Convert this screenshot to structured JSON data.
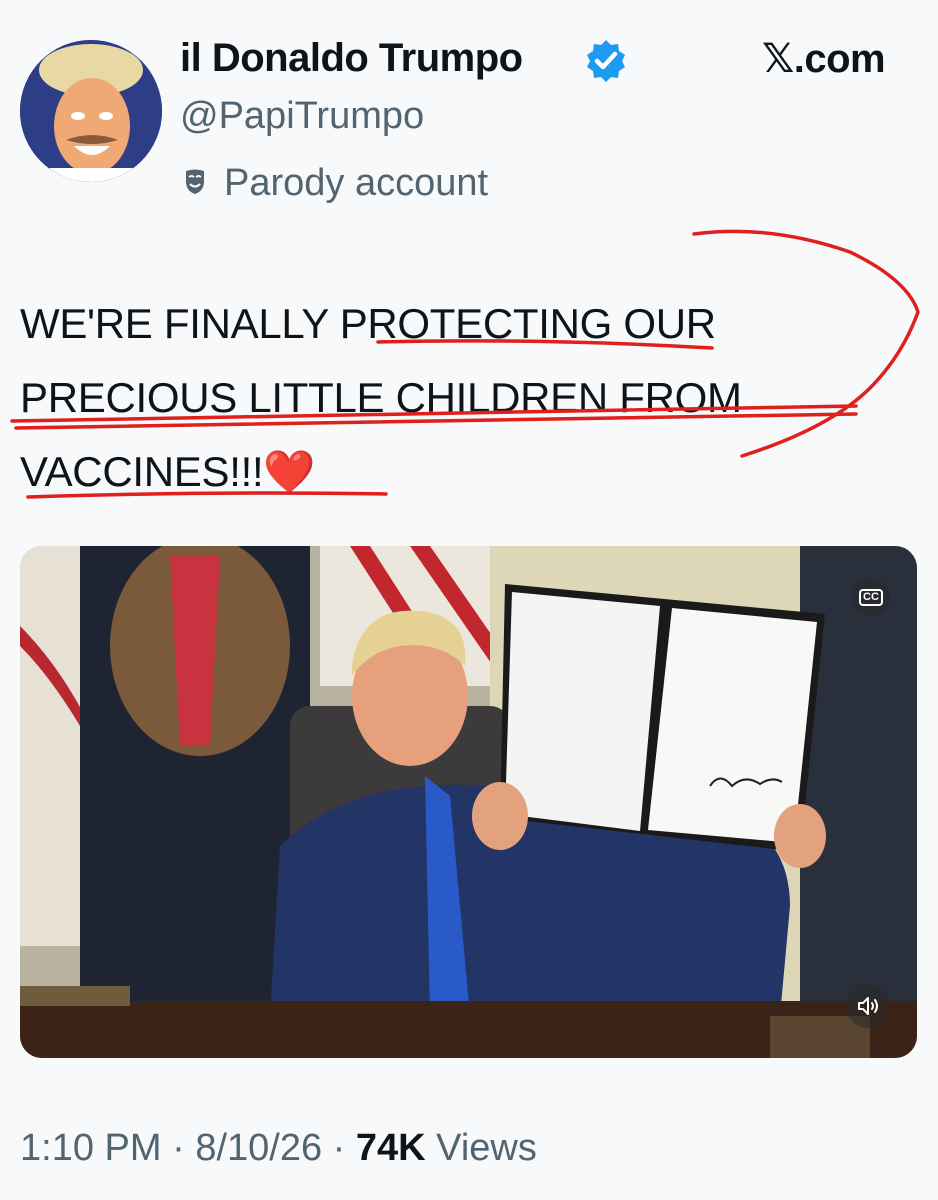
{
  "author": {
    "display_name": "il Donaldo Trumpo",
    "verified_icon": "verified-badge-icon",
    "handle": "@PapiTrumpo",
    "label_icon": "parody-mask-icon",
    "label": "Parody account"
  },
  "site": {
    "logo_glyph": "𝕏",
    "logo_suffix": ".com"
  },
  "tweet": {
    "text_before": "WE'RE FINALLY ",
    "text_emphasis": "PROTECTING",
    "text_after": " OUR PRECIOUS LITTLE CHILDREN FROM VACCINES!!!",
    "emoji": "❤️"
  },
  "media": {
    "type": "video",
    "cc_label": "CC",
    "cc_icon": "closed-captions-icon",
    "mute_icon": "speaker-muted-icon"
  },
  "meta": {
    "time": "1:10 PM",
    "separator": " · ",
    "date": "8/10/26",
    "views_count": "74K",
    "views_label": " Views"
  },
  "colors": {
    "verified_blue": "#1d9bf0",
    "secondary_text": "#536471",
    "annotation_red": "#e0201c",
    "background": "#f7f9fb"
  }
}
